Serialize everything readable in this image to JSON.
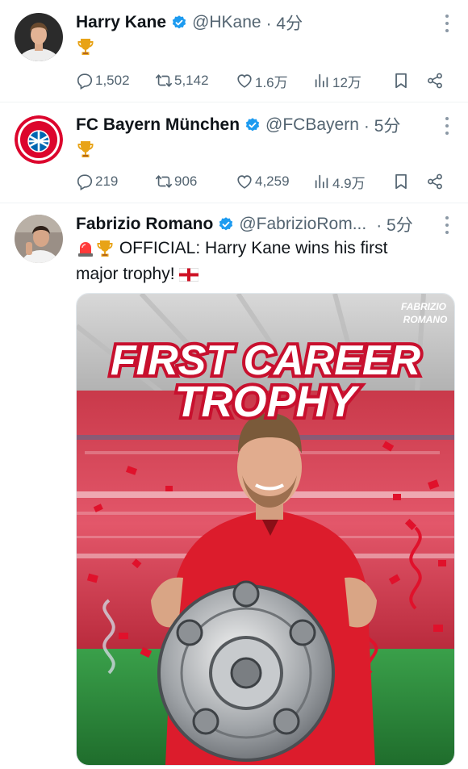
{
  "tweets": [
    {
      "name": "Harry Kane",
      "handle": "@HKane",
      "time": "· 4分",
      "content_icon": "trophy-emoji",
      "replies": "1,502",
      "retweets": "5,142",
      "likes": "1.6万",
      "views": "12万"
    },
    {
      "name": "FC Bayern München",
      "handle": "@FCBayern",
      "time": "· 5分",
      "content_icon": "trophy-emoji",
      "replies": "219",
      "retweets": "906",
      "likes": "4,259",
      "views": "4.9万"
    },
    {
      "name": "Fabrizio Romano",
      "handle": "@FabrizioRom...",
      "time": "· 5分",
      "text_line1": "OFFICIAL: Harry Kane wins his first",
      "text_line2": "major trophy!",
      "media": {
        "watermark_line1": "FABRIZIO",
        "watermark_line2": "ROMANO",
        "headline_line1": "FIRST CAREER",
        "headline_line2": "TROPHY"
      }
    }
  ],
  "colors": {
    "verified": "#1d9bf0",
    "muted": "#536471",
    "bayern_red": "#dc052d",
    "pitch_green": "#2f8a3a"
  }
}
